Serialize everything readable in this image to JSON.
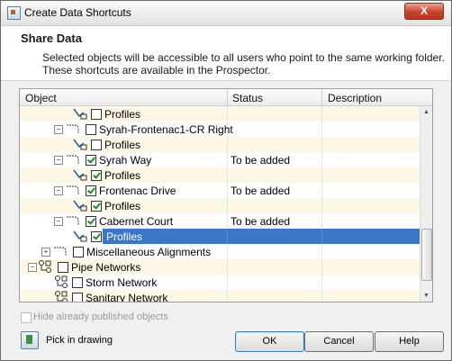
{
  "window": {
    "title": "Create Data Shortcuts",
    "close_label": "X"
  },
  "header": {
    "section_title": "Share Data",
    "description_lines": [
      "Selected objects will be accessible to all users who point to the same working folder.",
      "These shortcuts are available in the Prospector."
    ]
  },
  "tree": {
    "columns": [
      "Object",
      "Status",
      "Description"
    ],
    "rows": [
      {
        "label": "Profiles",
        "status": "",
        "checked": false
      },
      {
        "label": "Syrah-Frontenac1-CR Right",
        "status": "",
        "checked": false
      },
      {
        "label": "Profiles",
        "status": "",
        "checked": false
      },
      {
        "label": "Syrah Way",
        "status": "To be added",
        "checked": true
      },
      {
        "label": "Profiles",
        "status": "",
        "checked": true
      },
      {
        "label": "Frontenac Drive",
        "status": "To be added",
        "checked": true
      },
      {
        "label": "Profiles",
        "status": "",
        "checked": true
      },
      {
        "label": "Cabernet Court",
        "status": "To be added",
        "checked": true
      },
      {
        "label": "Profiles",
        "status": "",
        "checked": true,
        "selected": true
      },
      {
        "label": "Miscellaneous Alignments",
        "status": "",
        "checked": false
      },
      {
        "label": "Pipe Networks",
        "status": "",
        "checked": false
      },
      {
        "label": "Storm Network",
        "status": "",
        "checked": false
      },
      {
        "label": "Sanitary Network",
        "status": "",
        "checked": false
      }
    ]
  },
  "options": {
    "hide_published_label": "Hide already published objects",
    "hide_published_checked": false
  },
  "footer": {
    "pick_label": "Pick in drawing",
    "ok_label": "OK",
    "cancel_label": "Cancel",
    "help_label": "Help"
  }
}
